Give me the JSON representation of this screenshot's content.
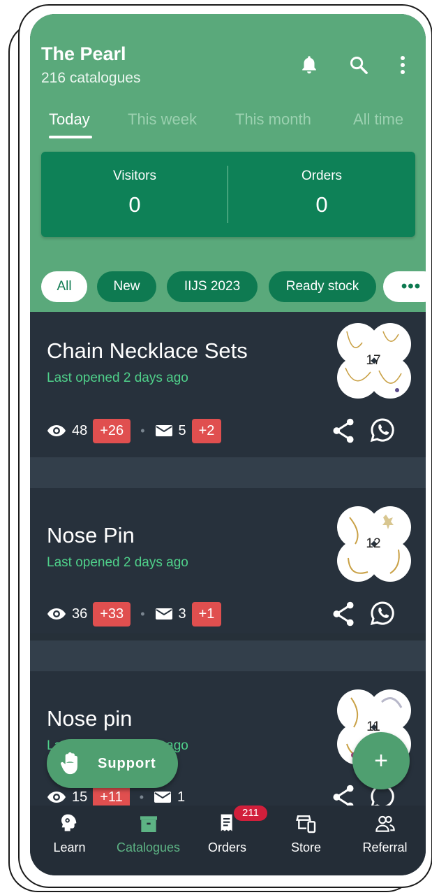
{
  "header": {
    "store_name": "The Pearl",
    "catalogue_count": "216 catalogues",
    "icons": [
      "bell-icon",
      "search-icon",
      "more-vert-icon"
    ]
  },
  "tabs": [
    {
      "label": "Today",
      "active": true
    },
    {
      "label": "This week",
      "active": false
    },
    {
      "label": "This month",
      "active": false
    },
    {
      "label": "All time",
      "active": false
    }
  ],
  "stats": {
    "visitors_label": "Visitors",
    "visitors_value": "0",
    "orders_label": "Orders",
    "orders_value": "0"
  },
  "chips": [
    {
      "label": "All",
      "active": true
    },
    {
      "label": "New",
      "active": false
    },
    {
      "label": "IIJS 2023",
      "active": false
    },
    {
      "label": "Ready stock",
      "active": false
    },
    {
      "label": "•••",
      "active": false
    }
  ],
  "catalogues": [
    {
      "title": "Chain Necklace Sets",
      "subtitle": "Last opened 2 days ago",
      "views": "48",
      "views_delta": "+26",
      "messages": "5",
      "messages_delta": "+2",
      "item_count": "17"
    },
    {
      "title": "Nose Pin",
      "subtitle": "Last opened 2 days ago",
      "views": "36",
      "views_delta": "+33",
      "messages": "3",
      "messages_delta": "+1",
      "item_count": "12"
    },
    {
      "title": "Nose pin",
      "subtitle": "Last opened 2 days ago",
      "views": "15",
      "views_delta": "+11",
      "messages": "1",
      "messages_delta": "",
      "item_count": "11"
    }
  ],
  "support": {
    "label": "Support"
  },
  "fab": {
    "label": "+"
  },
  "bottom_nav": [
    {
      "label": "Learn",
      "icon": "brain-gear-icon",
      "active": false
    },
    {
      "label": "Catalogues",
      "icon": "box-icon",
      "active": true
    },
    {
      "label": "Orders",
      "icon": "receipt-icon",
      "active": false,
      "badge": "211"
    },
    {
      "label": "Store",
      "icon": "store-icon",
      "active": false
    },
    {
      "label": "Referral",
      "icon": "people-icon",
      "active": false
    }
  ],
  "colors": {
    "header_green": "#5aa97b",
    "stats_green": "#0e8157",
    "accent_green": "#4fd08a",
    "badge_red": "#e04f4f",
    "card_dark": "#27313c"
  }
}
